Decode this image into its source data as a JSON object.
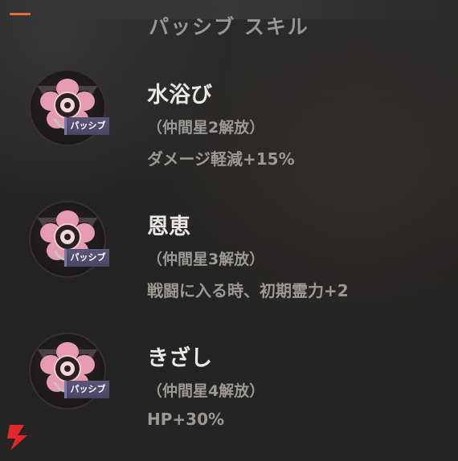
{
  "panel": {
    "title": "パッシブ スキル",
    "accent_color": "#e8693a"
  },
  "skills": [
    {
      "name": "水浴び",
      "condition": "（仲間星2解放）",
      "effect_text": "ダメージ軽減",
      "effect_value": "+15%",
      "badge": "パッシブ",
      "icon": "pink-flower-emblem-icon"
    },
    {
      "name": "恩恵",
      "condition": "（仲間星3解放）",
      "effect_text": "戦闘に入る時、初期霊力",
      "effect_value": "+2",
      "badge": "パッシブ",
      "icon": "pink-flower-emblem-icon"
    },
    {
      "name": "きざし",
      "condition": "（仲間星4解放）",
      "effect_text": "HP",
      "effect_value": "+30%",
      "badge": "パッシブ",
      "icon": "pink-flower-emblem-icon"
    }
  ],
  "colors": {
    "badge_bg": "#5b5678",
    "icon_pink": "#e59bb0",
    "bolt": "#e0282a"
  }
}
